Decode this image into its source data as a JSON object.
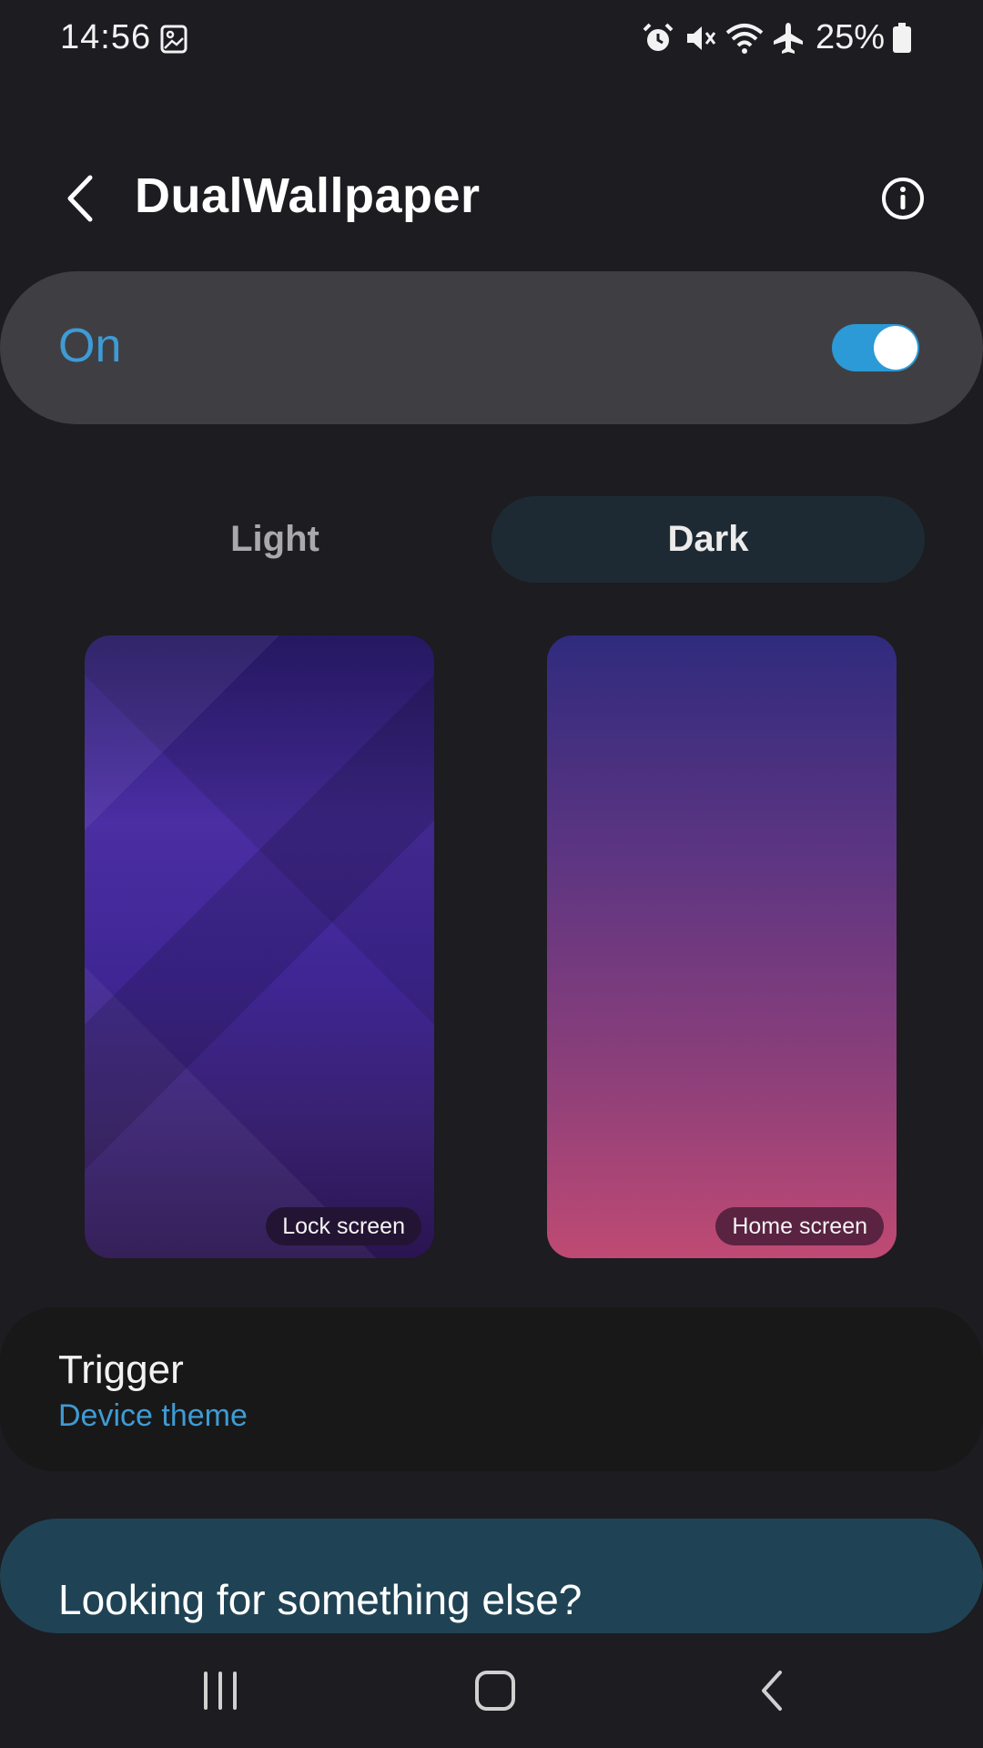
{
  "status_bar": {
    "time": "14:56",
    "battery": "25%",
    "icons": [
      "gallery-icon",
      "alarm-icon",
      "mute-icon",
      "wifi-icon",
      "airplane-icon",
      "battery-icon"
    ]
  },
  "header": {
    "title": "DualWallpaper",
    "back_icon": "back-arrow-icon",
    "info_icon": "info-icon"
  },
  "master_switch": {
    "label": "On",
    "enabled": true
  },
  "mode_tabs": [
    {
      "label": "Light",
      "selected": false
    },
    {
      "label": "Dark",
      "selected": true
    }
  ],
  "previews": {
    "lock_label": "Lock screen",
    "home_label": "Home screen"
  },
  "trigger": {
    "title": "Trigger",
    "value": "Device theme"
  },
  "suggestion": {
    "title": "Looking for something else?"
  },
  "colors": {
    "accent": "#3e9bd5",
    "background": "#1c1c21",
    "card": "#3f3f43"
  },
  "nav_bar": {
    "icons": [
      "recents-icon",
      "home-icon",
      "back-icon"
    ]
  }
}
